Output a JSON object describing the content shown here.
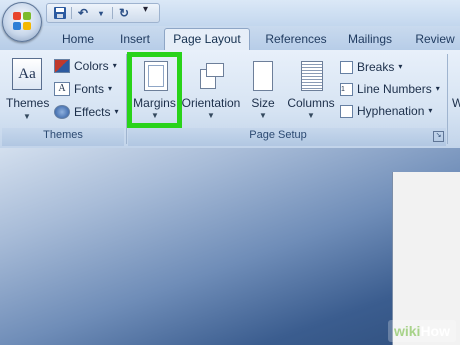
{
  "tabs": [
    "Home",
    "Insert",
    "Page Layout",
    "References",
    "Mailings",
    "Review"
  ],
  "active_tab": "Page Layout",
  "groups": {
    "themes": {
      "label": "Themes",
      "themes_button": "Themes",
      "colors": "Colors",
      "fonts": "Fonts",
      "effects": "Effects"
    },
    "page_setup": {
      "label": "Page Setup",
      "margins": "Margins",
      "orientation": "Orientation",
      "size": "Size",
      "columns": "Columns",
      "breaks": "Breaks",
      "line_numbers": "Line Numbers",
      "hyphenation": "Hyphenation"
    }
  },
  "watermark": {
    "wiki": "wiki",
    "how": "How"
  },
  "colors": {
    "highlight": "#29d31a",
    "accent": "#2b4f86"
  }
}
